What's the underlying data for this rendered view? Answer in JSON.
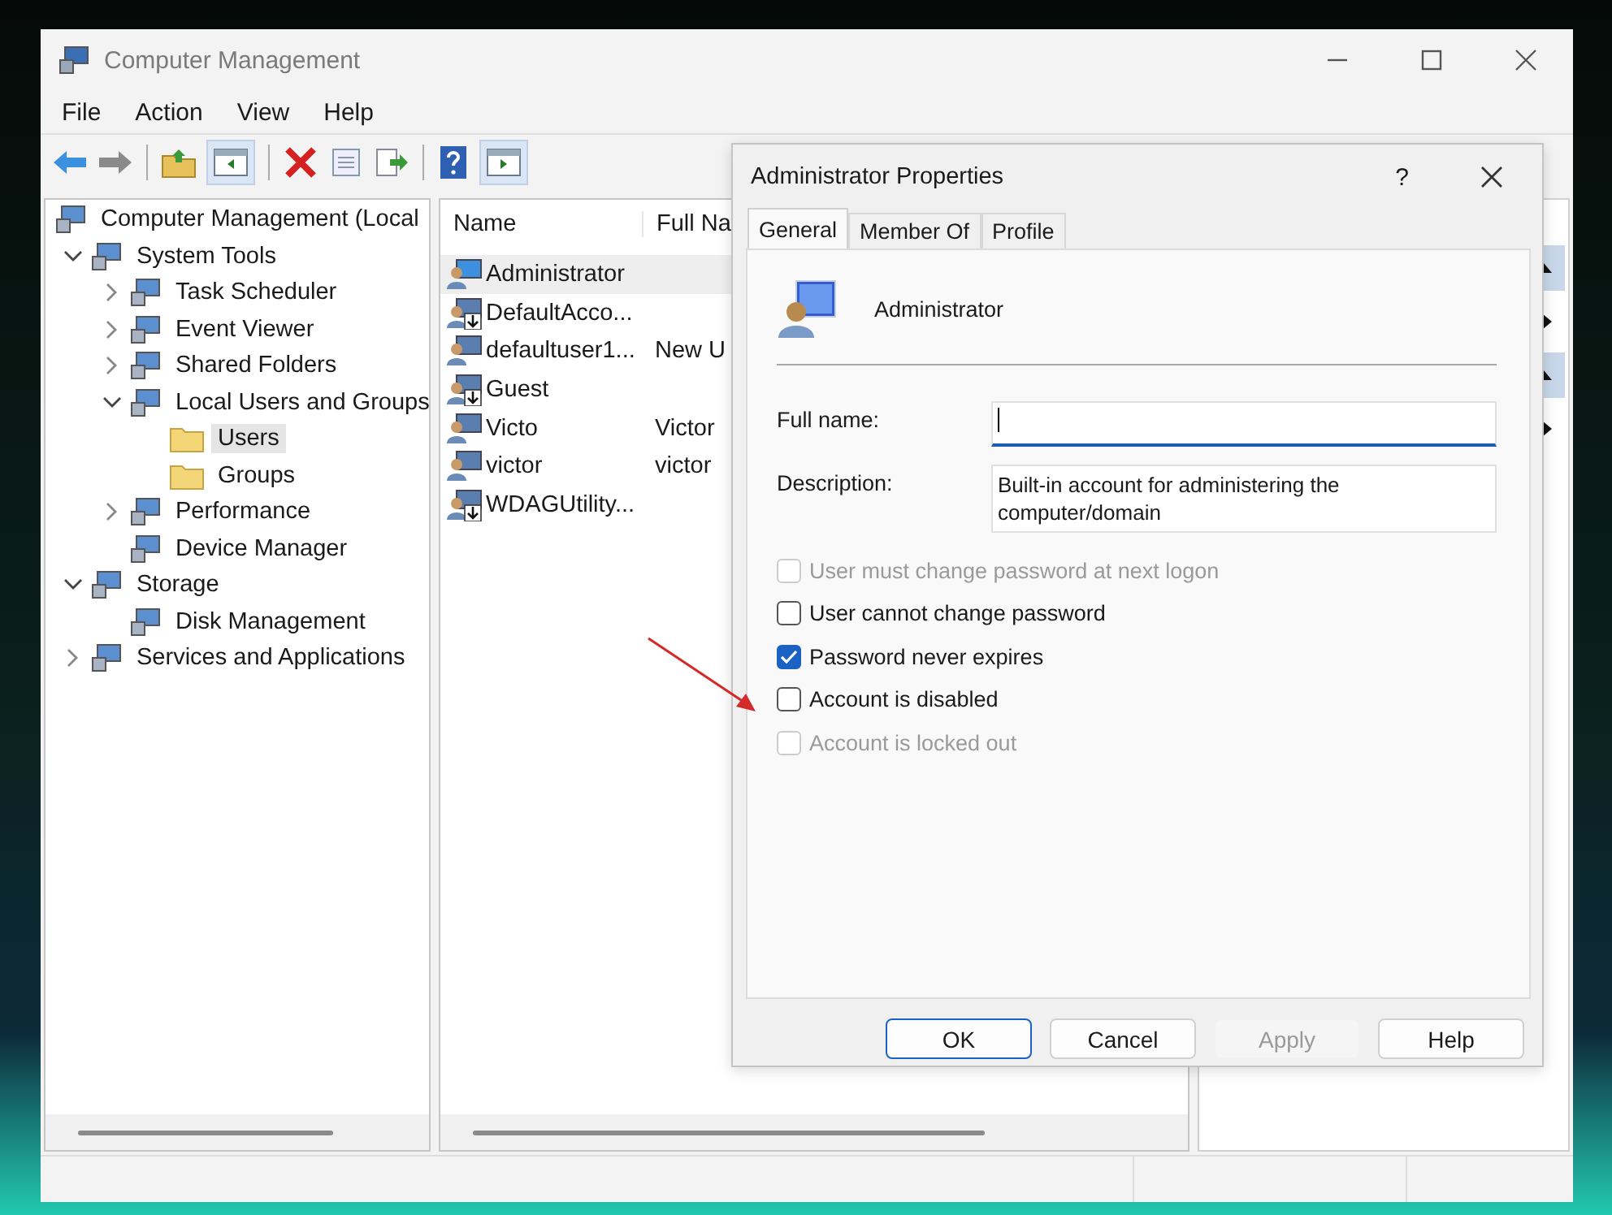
{
  "window": {
    "title": "Computer Management"
  },
  "menu": [
    "File",
    "Action",
    "View",
    "Help"
  ],
  "tree": [
    {
      "label": "Computer Management (Local",
      "selected": false,
      "children": [
        {
          "label": "System Tools",
          "expanded": true,
          "selected": false,
          "children": [
            {
              "label": "Task Scheduler",
              "expanded": false,
              "selected": false
            },
            {
              "label": "Event Viewer",
              "expanded": false,
              "selected": false
            },
            {
              "label": "Shared Folders",
              "expanded": false,
              "selected": false
            },
            {
              "label": "Local Users and Groups",
              "expanded": true,
              "selected": false,
              "children": [
                {
                  "label": "Users",
                  "selected": true
                },
                {
                  "label": "Groups",
                  "selected": false
                }
              ]
            },
            {
              "label": "Performance",
              "expanded": false,
              "selected": false
            },
            {
              "label": "Device Manager",
              "selected": false
            }
          ]
        },
        {
          "label": "Storage",
          "expanded": true,
          "selected": false,
          "children": [
            {
              "label": "Disk Management",
              "selected": false
            }
          ]
        },
        {
          "label": "Services and Applications",
          "expanded": false,
          "selected": false
        }
      ]
    }
  ],
  "list": {
    "columns": [
      "Name",
      "Full Na"
    ],
    "rows": [
      {
        "name": "Administrator",
        "selected": true,
        "disabled": false
      },
      {
        "name": "DefaultAcco...",
        "selected": false,
        "disabled": true
      },
      {
        "name": "defaultuser1...",
        "full_name": "New U",
        "selected": false,
        "disabled": false
      },
      {
        "name": "Guest",
        "selected": false,
        "disabled": true
      },
      {
        "name": "Victo",
        "full_name": "Victor",
        "selected": false,
        "disabled": false
      },
      {
        "name": "victor",
        "full_name": "victor",
        "selected": false,
        "disabled": false
      },
      {
        "name": "WDAGUtility...",
        "selected": false,
        "disabled": true
      }
    ]
  },
  "dialog": {
    "title": "Administrator Properties",
    "help": "?",
    "tabs": [
      {
        "label": "General",
        "selected": true
      },
      {
        "label": "Member Of",
        "selected": false
      },
      {
        "label": "Profile",
        "selected": false
      }
    ],
    "user_name": "Administrator",
    "fields": [
      {
        "label": "Full name:",
        "focused": true
      },
      {
        "label": "Description:",
        "value": "Built-in account for administering the computer/domain",
        "focused": false
      }
    ],
    "checkboxes": [
      {
        "label": "User must change password at next logon",
        "checked": false,
        "disabled": true
      },
      {
        "label": "User cannot change password",
        "checked": false,
        "disabled": false
      },
      {
        "label": "Password never expires",
        "checked": true,
        "disabled": false
      },
      {
        "label": "Account is disabled",
        "checked": false,
        "disabled": false
      },
      {
        "label": "Account is locked out",
        "checked": false,
        "disabled": true
      }
    ],
    "buttons": [
      {
        "label": "OK",
        "default": true,
        "disabled": false
      },
      {
        "label": "Cancel",
        "default": false,
        "disabled": false
      },
      {
        "label": "Apply",
        "default": false,
        "disabled": true
      },
      {
        "label": "Help",
        "default": false,
        "disabled": false
      }
    ]
  }
}
